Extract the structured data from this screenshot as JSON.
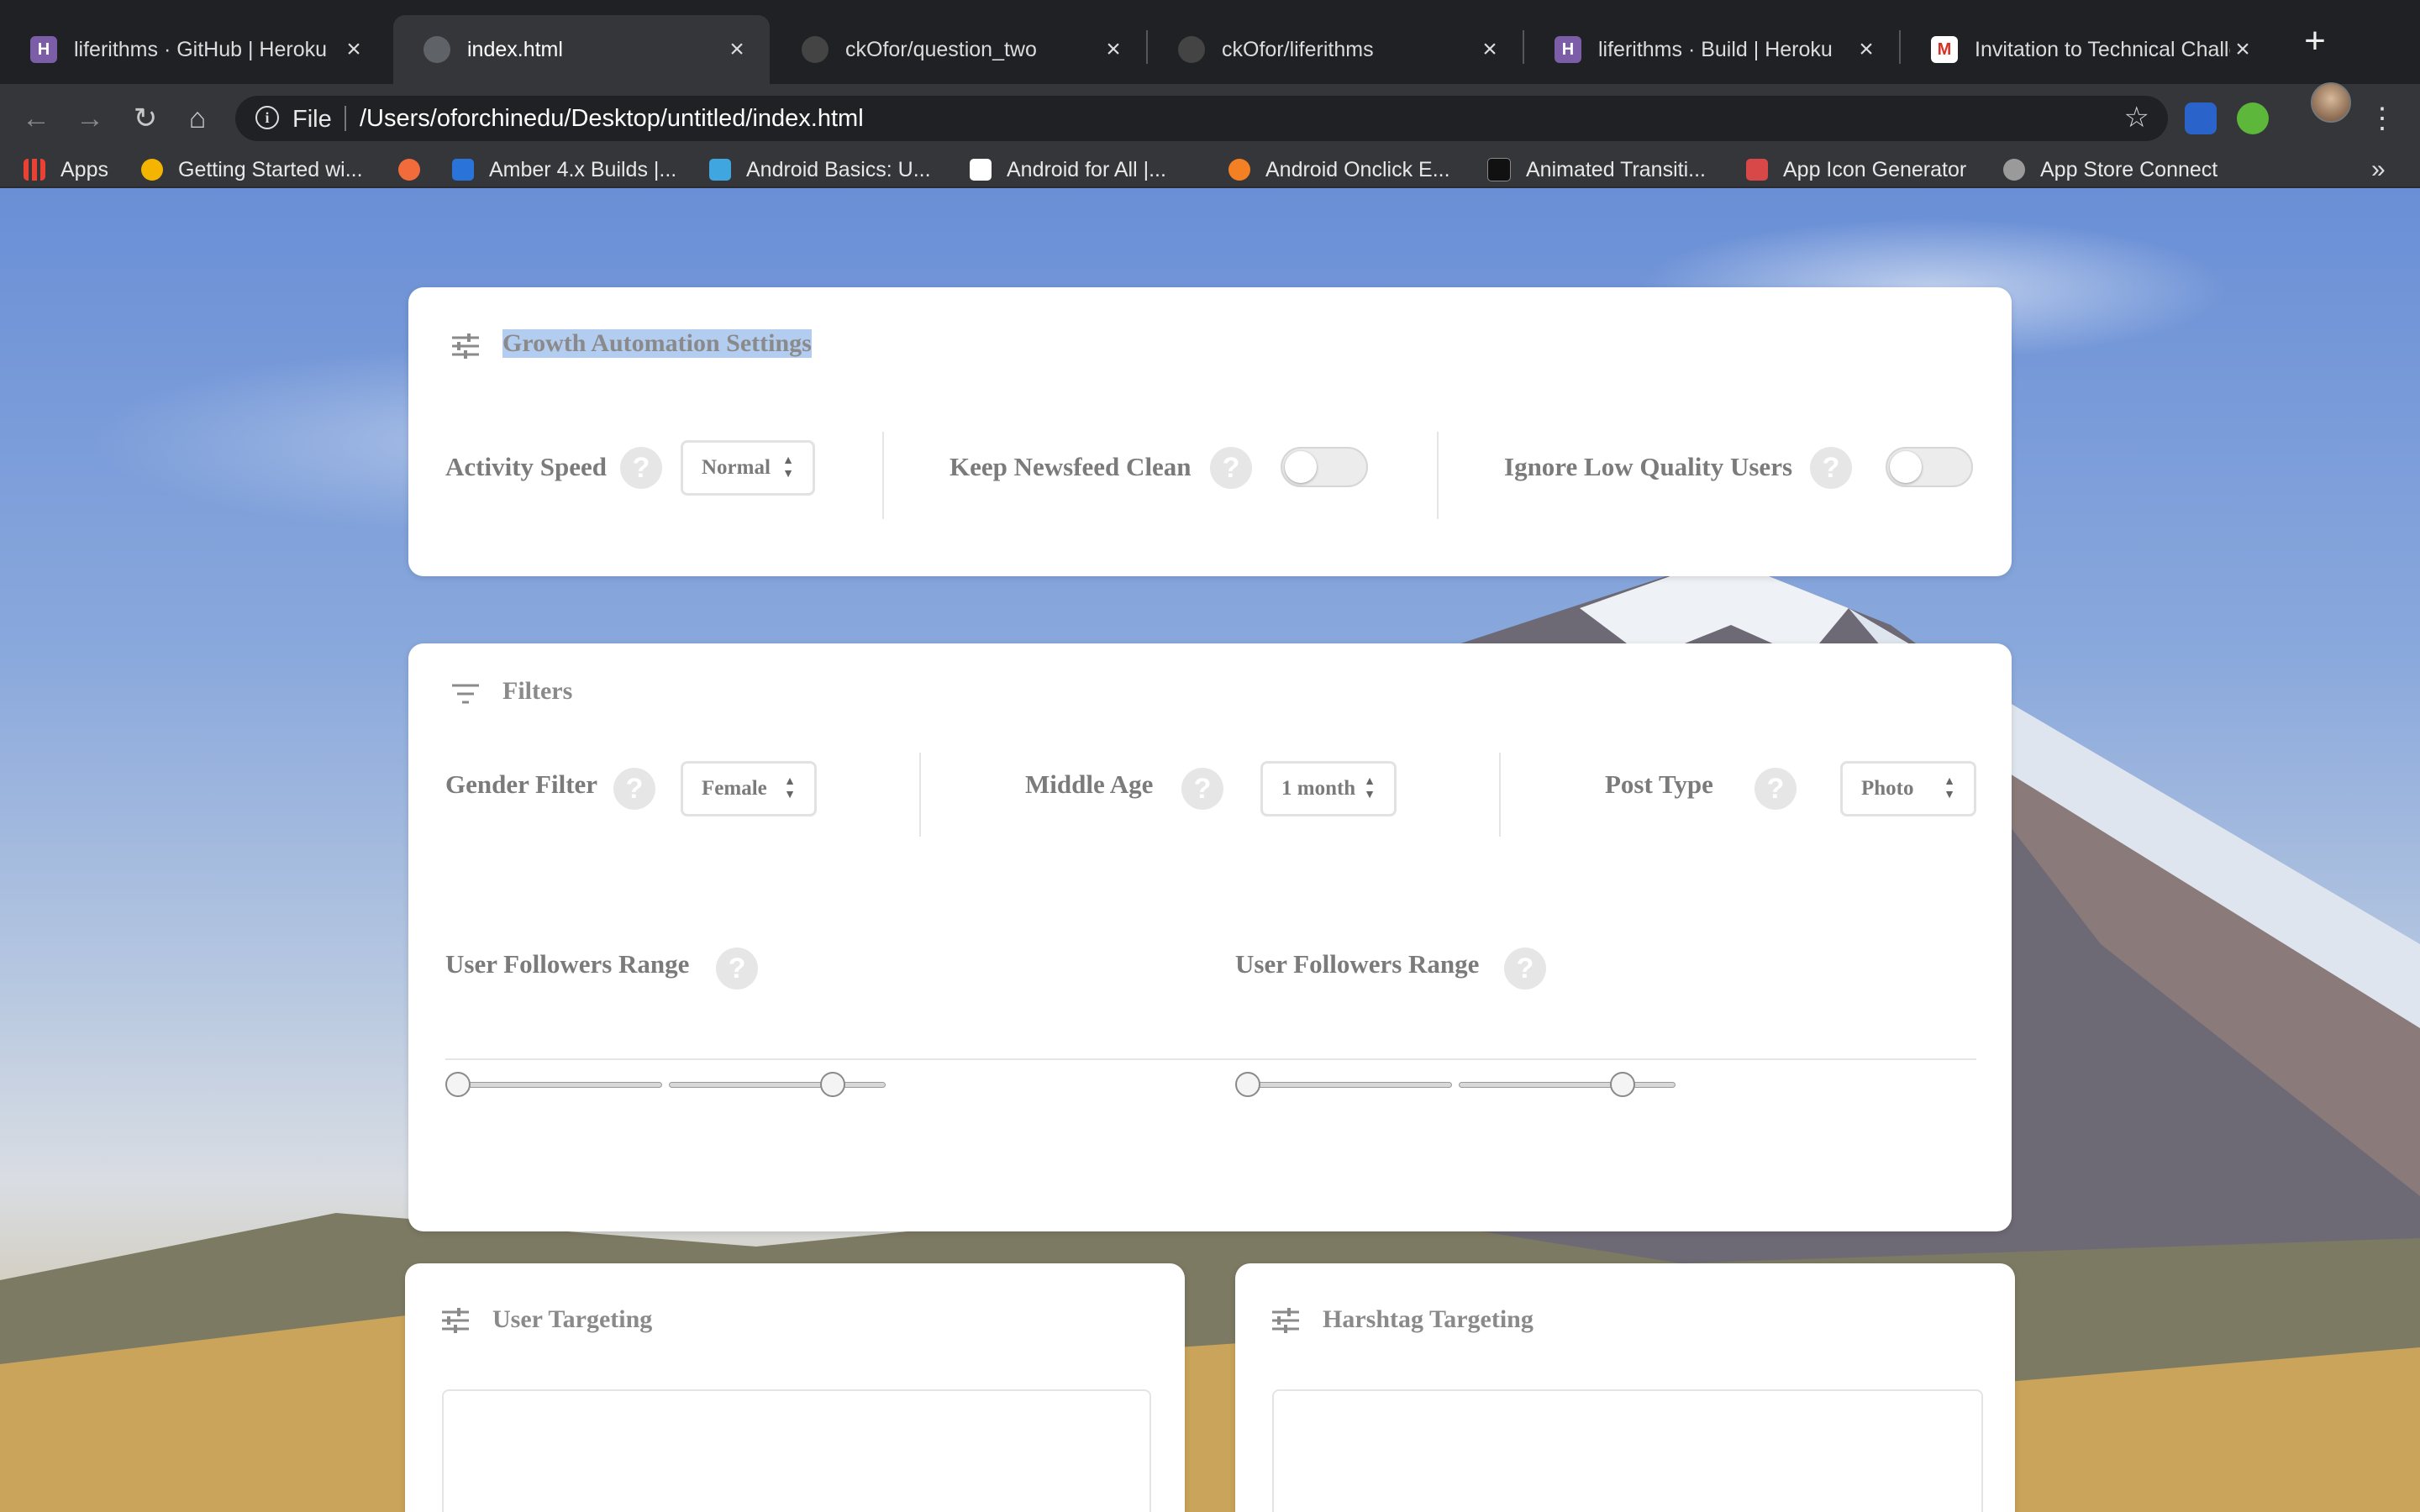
{
  "browser": {
    "tabs": [
      {
        "title": "liferithms · GitHub | Heroku",
        "icon": "heroku-icon",
        "active": false
      },
      {
        "title": "index.html",
        "icon": "globe-icon",
        "active": true
      },
      {
        "title": "ckOfor/question_two",
        "icon": "github-icon",
        "active": false
      },
      {
        "title": "ckOfor/liferithms",
        "icon": "github-icon",
        "active": false
      },
      {
        "title": "liferithms · Build | Heroku",
        "icon": "heroku-icon",
        "active": false
      },
      {
        "title": "Invitation to Technical Challe",
        "icon": "gmail-icon",
        "active": false
      }
    ],
    "address": {
      "scheme": "File",
      "url": "/Users/oforchinedu/Desktop/untitled/index.html"
    },
    "bookmarks": [
      {
        "label": "Apps",
        "color": "#e94235"
      },
      {
        "label": "Getting Started wi...",
        "color": "#f4b400"
      },
      {
        "label": "",
        "color": "#f26b3a"
      },
      {
        "label": "Amber 4.x Builds |...",
        "color": "#2a73d9"
      },
      {
        "label": "Android Basics: U...",
        "color": "#3fa6e0"
      },
      {
        "label": "Android for All  |...",
        "color": "#ffffff"
      },
      {
        "label": "Android Onclick E...",
        "color": "#f48024"
      },
      {
        "label": "Animated Transiti...",
        "color": "#111111"
      },
      {
        "label": "App Icon Generator",
        "color": "#d94848"
      },
      {
        "label": "App Store Connect",
        "color": "#9a9a9a"
      }
    ]
  },
  "growth": {
    "title": "Growth Automation Settings",
    "activity_speed": {
      "label": "Activity Speed",
      "value": "Normal"
    },
    "keep_newsfeed": {
      "label": "Keep Newsfeed Clean",
      "on": false
    },
    "ignore_low": {
      "label": "Ignore Low Quality Users",
      "on": false
    }
  },
  "filters": {
    "title": "Filters",
    "gender": {
      "label": "Gender Filter",
      "value": "Female"
    },
    "middle_age": {
      "label": "Middle Age",
      "value": "1 month"
    },
    "post_type": {
      "label": "Post Type",
      "value": "Photo"
    },
    "range_left": {
      "label": "User Followers Range"
    },
    "range_right": {
      "label": "User Followers Range"
    }
  },
  "user_targeting": {
    "title": "User Targeting"
  },
  "hashtag_targeting": {
    "title": "Harshtag Targeting"
  },
  "help_glyph": "?",
  "colors": {
    "selection": "#b3cdf0",
    "card": "#ffffff",
    "label": "#7b7b7b"
  }
}
